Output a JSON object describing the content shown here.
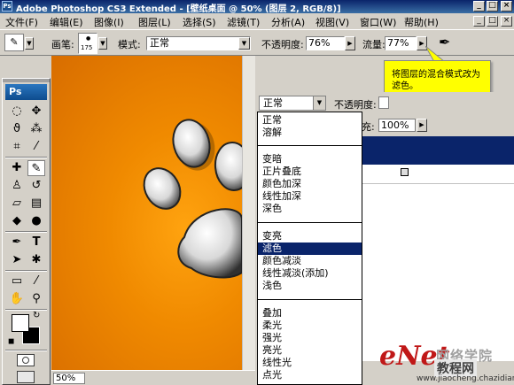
{
  "window": {
    "icon": "Ps",
    "title": "Adobe Photoshop CS3 Extended - [壁纸桌面 @ 50% (图层 2, RGB/8)]",
    "controls": [
      "_",
      "□",
      "×"
    ]
  },
  "menu": {
    "items": [
      "文件(F)",
      "编辑(E)",
      "图像(I)",
      "图层(L)",
      "选择(S)",
      "滤镜(T)",
      "分析(A)",
      "视图(V)",
      "窗口(W)",
      "帮助(H)"
    ]
  },
  "options": {
    "brush_label": "画笔:",
    "brush_size": "175",
    "mode_label": "模式:",
    "mode_value": "正常",
    "opacity_label": "不透明度:",
    "opacity_value": "76%",
    "flow_label": "流量:",
    "flow_value": "77%"
  },
  "callout": {
    "text": "将图层的混合模式改为滤色。"
  },
  "toolbox": {
    "logo": "Ps",
    "tools": [
      {
        "name": "marquee-tool-icon",
        "glyph": "◌"
      },
      {
        "name": "move-tool-icon",
        "glyph": "✥"
      },
      {
        "name": "lasso-tool-icon",
        "glyph": "ϑ"
      },
      {
        "name": "magic-wand-tool-icon",
        "glyph": "⁂"
      },
      {
        "name": "crop-tool-icon",
        "glyph": "⌗"
      },
      {
        "name": "eyedropper-tool-icon",
        "glyph": "⁄"
      },
      {
        "name": "healing-brush-tool-icon",
        "glyph": "✚"
      },
      {
        "name": "brush-tool-icon",
        "glyph": "✎"
      },
      {
        "name": "stamp-tool-icon",
        "glyph": "♙"
      },
      {
        "name": "history-brush-tool-icon",
        "glyph": "↺"
      },
      {
        "name": "eraser-tool-icon",
        "glyph": "▱"
      },
      {
        "name": "gradient-tool-icon",
        "glyph": "▤"
      },
      {
        "name": "blur-tool-icon",
        "glyph": "◆"
      },
      {
        "name": "dodge-tool-icon",
        "glyph": "●"
      },
      {
        "name": "pen-tool-icon",
        "glyph": "✒"
      },
      {
        "name": "type-tool-icon",
        "glyph": "T"
      },
      {
        "name": "path-selection-tool-icon",
        "glyph": "➤"
      },
      {
        "name": "shape-tool-icon",
        "glyph": "✱"
      },
      {
        "name": "notes-tool-icon",
        "glyph": "▭"
      },
      {
        "name": "eyedropper2-tool-icon",
        "glyph": "⁄"
      },
      {
        "name": "hand-tool-icon",
        "glyph": "✋"
      },
      {
        "name": "zoom-tool-icon",
        "glyph": "⚲"
      }
    ]
  },
  "status": {
    "zoom": "50%"
  },
  "layers": {
    "blend_mode": "正常",
    "opacity_label": "不透明度:",
    "fill_label": "充:",
    "fill_value": "100%"
  },
  "blend_menu": {
    "groups": [
      [
        "正常",
        "溶解"
      ],
      [
        "变暗",
        "正片叠底",
        "颜色加深",
        "线性加深",
        "深色"
      ],
      [
        "变亮",
        "滤色",
        "颜色减淡",
        "线性减淡(添加)",
        "浅色"
      ],
      [
        "叠加",
        "柔光",
        "强光",
        "亮光",
        "线性光",
        "点光"
      ]
    ],
    "selected": "滤色"
  },
  "watermark": {
    "logo": "eNet",
    "line1": "网络学院",
    "line2": "教程网",
    "url": "www.jiaocheng.chazidian.com"
  },
  "colors": {
    "canvas_orange": "#f08a00",
    "highlight": "#0a246a",
    "tooltip": "#ffff00"
  }
}
